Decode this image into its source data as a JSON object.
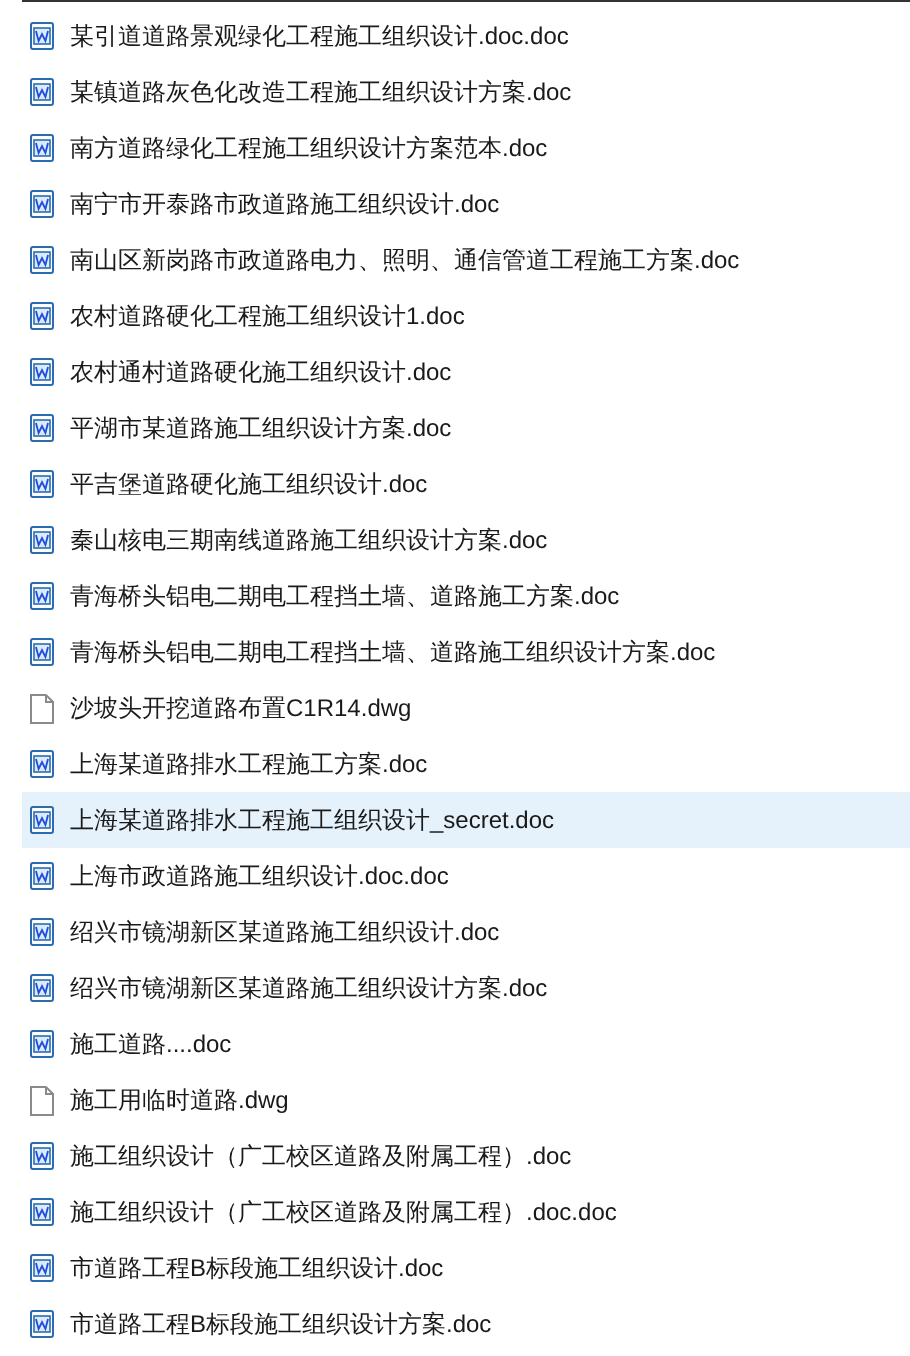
{
  "files": [
    {
      "name": "某引道道路景观绿化工程施工组织设计.doc.doc",
      "kind": "doc",
      "selected": false
    },
    {
      "name": "某镇道路灰色化改造工程施工组织设计方案.doc",
      "kind": "doc",
      "selected": false
    },
    {
      "name": "南方道路绿化工程施工组织设计方案范本.doc",
      "kind": "doc",
      "selected": false
    },
    {
      "name": "南宁市开泰路市政道路施工组织设计.doc",
      "kind": "doc",
      "selected": false
    },
    {
      "name": "南山区新岗路市政道路电力、照明、通信管道工程施工方案.doc",
      "kind": "doc",
      "selected": false
    },
    {
      "name": "农村道路硬化工程施工组织设计1.doc",
      "kind": "doc",
      "selected": false
    },
    {
      "name": "农村通村道路硬化施工组织设计.doc",
      "kind": "doc",
      "selected": false
    },
    {
      "name": "平湖市某道路施工组织设计方案.doc",
      "kind": "doc",
      "selected": false
    },
    {
      "name": "平吉堡道路硬化施工组织设计.doc",
      "kind": "doc",
      "selected": false
    },
    {
      "name": "秦山核电三期南线道路施工组织设计方案.doc",
      "kind": "doc",
      "selected": false
    },
    {
      "name": "青海桥头铝电二期电工程挡土墙、道路施工方案.doc",
      "kind": "doc",
      "selected": false
    },
    {
      "name": "青海桥头铝电二期电工程挡土墙、道路施工组织设计方案.doc",
      "kind": "doc",
      "selected": false
    },
    {
      "name": "沙坡头开挖道路布置C1R14.dwg",
      "kind": "dwg",
      "selected": false
    },
    {
      "name": "上海某道路排水工程施工方案.doc",
      "kind": "doc",
      "selected": false
    },
    {
      "name": "上海某道路排水工程施工组织设计_secret.doc",
      "kind": "doc",
      "selected": true
    },
    {
      "name": "上海市政道路施工组织设计.doc.doc",
      "kind": "doc",
      "selected": false
    },
    {
      "name": "绍兴市镜湖新区某道路施工组织设计.doc",
      "kind": "doc",
      "selected": false
    },
    {
      "name": "绍兴市镜湖新区某道路施工组织设计方案.doc",
      "kind": "doc",
      "selected": false
    },
    {
      "name": "施工道路....doc",
      "kind": "doc",
      "selected": false
    },
    {
      "name": "施工用临时道路.dwg",
      "kind": "dwg",
      "selected": false
    },
    {
      "name": "施工组织设计（广工校区道路及附属工程）.doc",
      "kind": "doc",
      "selected": false
    },
    {
      "name": "施工组织设计（广工校区道路及附属工程）.doc.doc",
      "kind": "doc",
      "selected": false
    },
    {
      "name": "市道路工程B标段施工组织设计.doc",
      "kind": "doc",
      "selected": false
    },
    {
      "name": "市道路工程B标段施工组织设计方案.doc",
      "kind": "doc",
      "selected": false
    }
  ]
}
